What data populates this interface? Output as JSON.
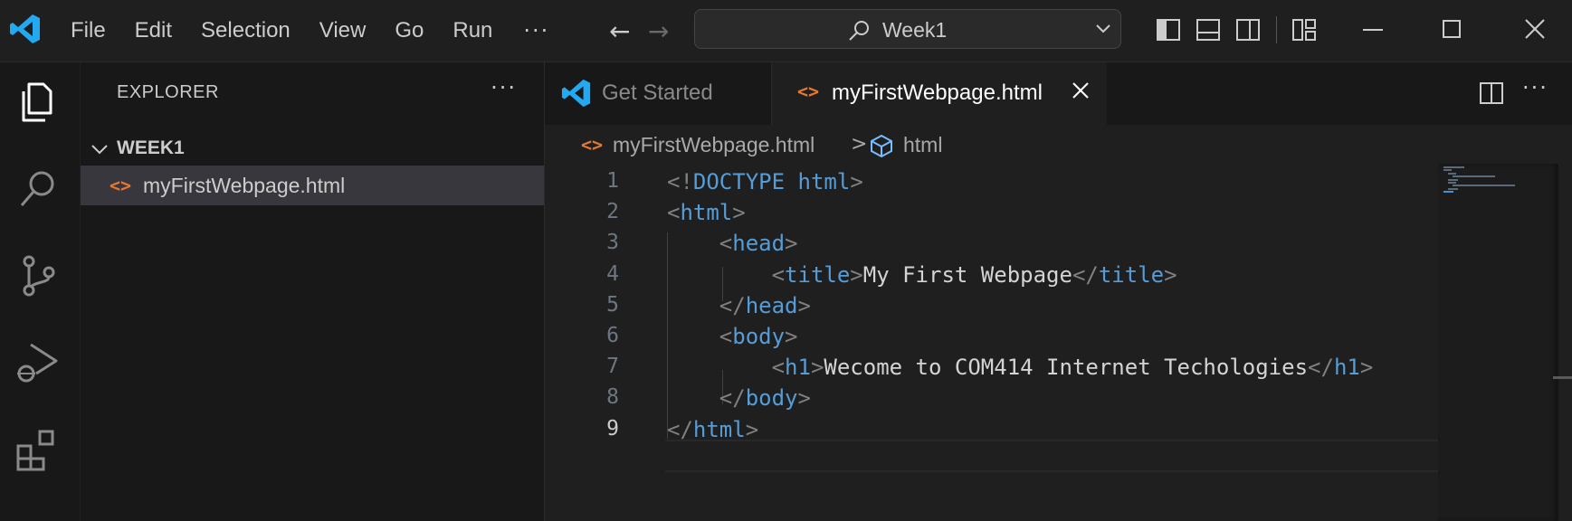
{
  "titlebar": {
    "menu": [
      "File",
      "Edit",
      "Selection",
      "View",
      "Go",
      "Run"
    ],
    "more": "···",
    "back_arrow": "←",
    "forward_arrow": "→",
    "search_text": "Week1"
  },
  "sidebar": {
    "title": "EXPLORER",
    "more": "···",
    "folder": "WEEK1",
    "files": [
      {
        "icon": "<>",
        "name": "myFirstWebpage.html"
      }
    ]
  },
  "tabs": [
    {
      "label": "Get Started",
      "icon": "vscode-logo-icon",
      "active": false
    },
    {
      "label": "myFirstWebpage.html",
      "icon": "<>",
      "active": true
    }
  ],
  "tab_more": "···",
  "breadcrumb": {
    "icon": "<>",
    "file": "myFirstWebpage.html",
    "sep": ">",
    "symbol": "html"
  },
  "editor": {
    "active_line": 9,
    "lines": [
      {
        "n": "1",
        "indent": 0,
        "tokens": [
          [
            "br",
            "<!"
          ],
          [
            "tag",
            "DOCTYPE"
          ],
          [
            "txt",
            " "
          ],
          [
            "tag",
            "html"
          ],
          [
            "br",
            ">"
          ]
        ]
      },
      {
        "n": "2",
        "indent": 0,
        "tokens": [
          [
            "br",
            "<"
          ],
          [
            "tag",
            "html"
          ],
          [
            "br",
            ">"
          ]
        ]
      },
      {
        "n": "3",
        "indent": 1,
        "tokens": [
          [
            "br",
            "<"
          ],
          [
            "tag",
            "head"
          ],
          [
            "br",
            ">"
          ]
        ]
      },
      {
        "n": "4",
        "indent": 2,
        "tokens": [
          [
            "br",
            "<"
          ],
          [
            "tag",
            "title"
          ],
          [
            "br",
            ">"
          ],
          [
            "txt",
            "My First Webpage"
          ],
          [
            "br",
            "</"
          ],
          [
            "tag",
            "title"
          ],
          [
            "br",
            ">"
          ]
        ]
      },
      {
        "n": "5",
        "indent": 1,
        "tokens": [
          [
            "br",
            "</"
          ],
          [
            "tag",
            "head"
          ],
          [
            "br",
            ">"
          ]
        ]
      },
      {
        "n": "6",
        "indent": 1,
        "tokens": [
          [
            "br",
            "<"
          ],
          [
            "tag",
            "body"
          ],
          [
            "br",
            ">"
          ]
        ]
      },
      {
        "n": "7",
        "indent": 2,
        "tokens": [
          [
            "br",
            "<"
          ],
          [
            "tag",
            "h1"
          ],
          [
            "br",
            ">"
          ],
          [
            "txt",
            "Wecome to COM414 Internet Techologies"
          ],
          [
            "br",
            "</"
          ],
          [
            "tag",
            "h1"
          ],
          [
            "br",
            ">"
          ]
        ]
      },
      {
        "n": "8",
        "indent": 1,
        "tokens": [
          [
            "br",
            "</"
          ],
          [
            "tag",
            "body"
          ],
          [
            "br",
            ">"
          ]
        ]
      },
      {
        "n": "9",
        "indent": 0,
        "tokens": [
          [
            "br",
            "</"
          ],
          [
            "tag",
            "html"
          ],
          [
            "br",
            ">"
          ]
        ]
      }
    ]
  },
  "colors": {
    "accent": "#0078d4",
    "html_icon": "#e37933",
    "tag": "#569cd6",
    "bracket": "#808080",
    "text": "#d4d4d4"
  }
}
